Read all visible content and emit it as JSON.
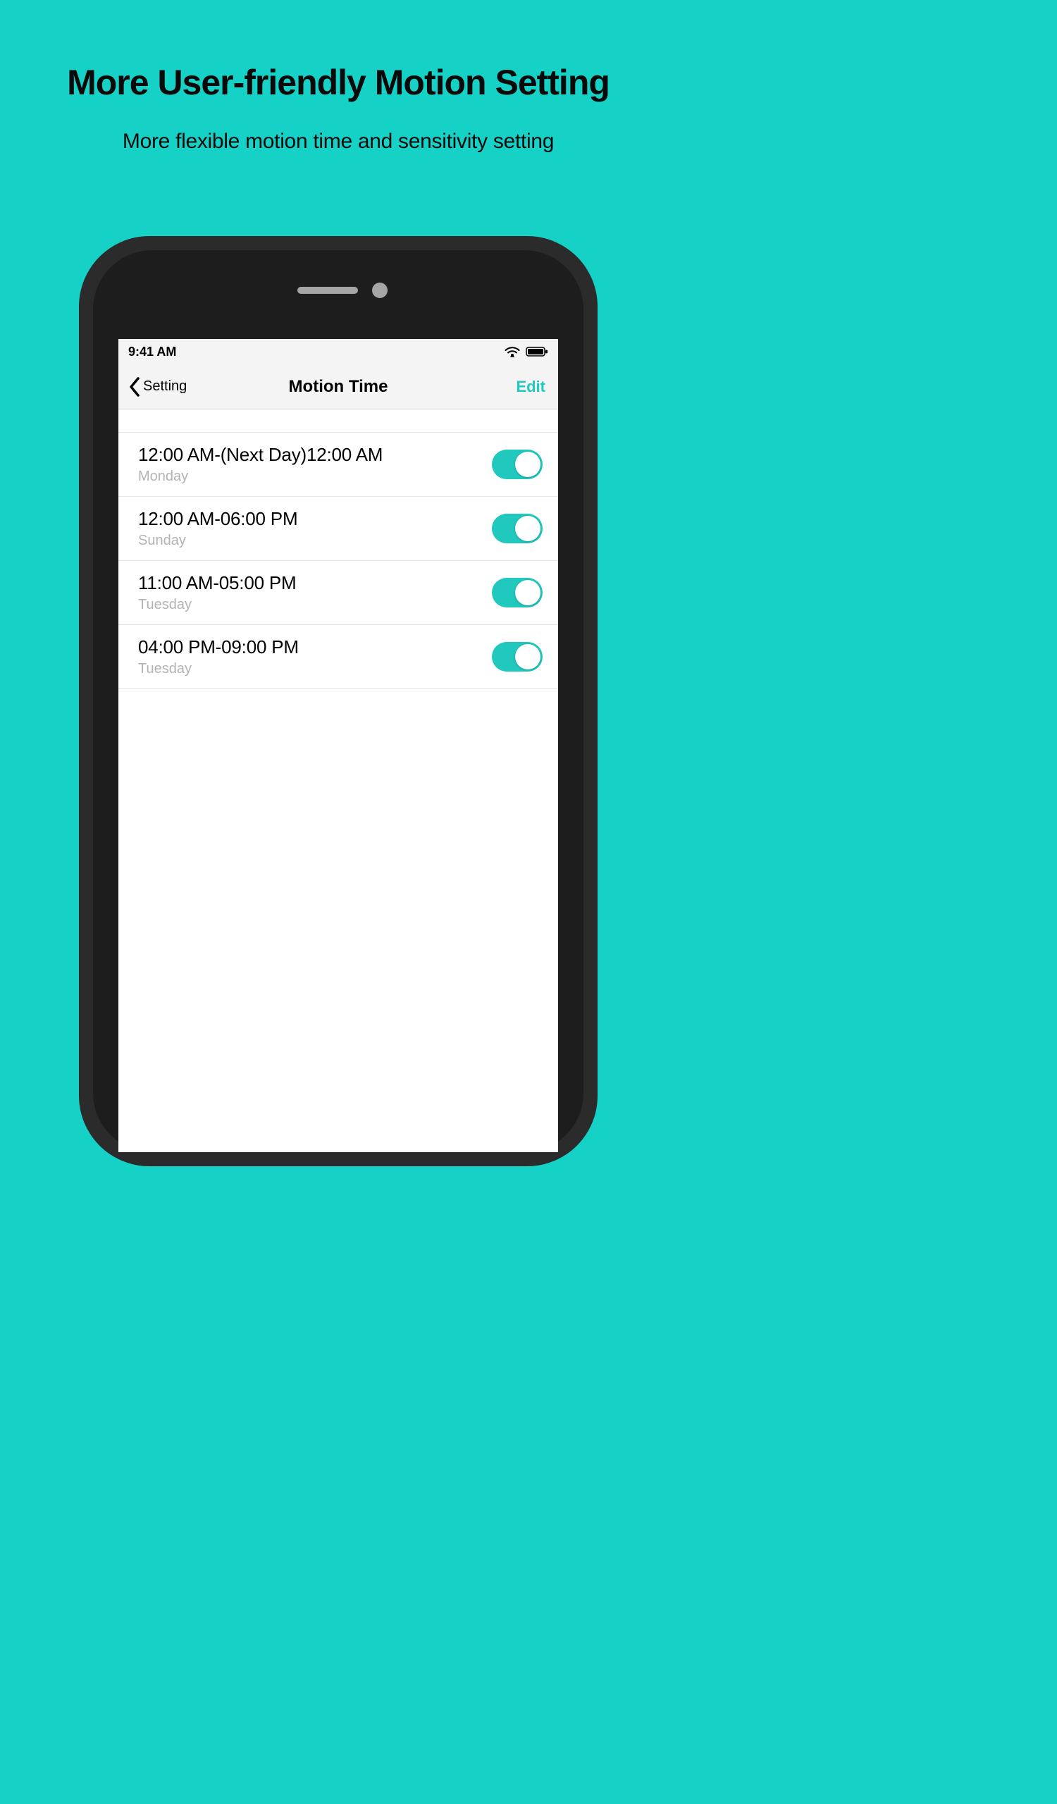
{
  "promo": {
    "title": "More User-friendly Motion Setting",
    "subtitle": "More flexible motion time and sensitivity setting"
  },
  "status_bar": {
    "time": "9:41 AM"
  },
  "nav": {
    "back_label": "Setting",
    "title": "Motion Time",
    "edit_label": "Edit"
  },
  "colors": {
    "background": "#16d1c6",
    "accent": "#20c8bd"
  },
  "rows": [
    {
      "time_range": "12:00 AM-(Next Day)12:00 AM",
      "day": "Monday",
      "enabled": true
    },
    {
      "time_range": "12:00 AM-06:00 PM",
      "day": "Sunday",
      "enabled": true
    },
    {
      "time_range": "11:00 AM-05:00 PM",
      "day": "Tuesday",
      "enabled": true
    },
    {
      "time_range": "04:00 PM-09:00 PM",
      "day": "Tuesday",
      "enabled": true
    }
  ]
}
